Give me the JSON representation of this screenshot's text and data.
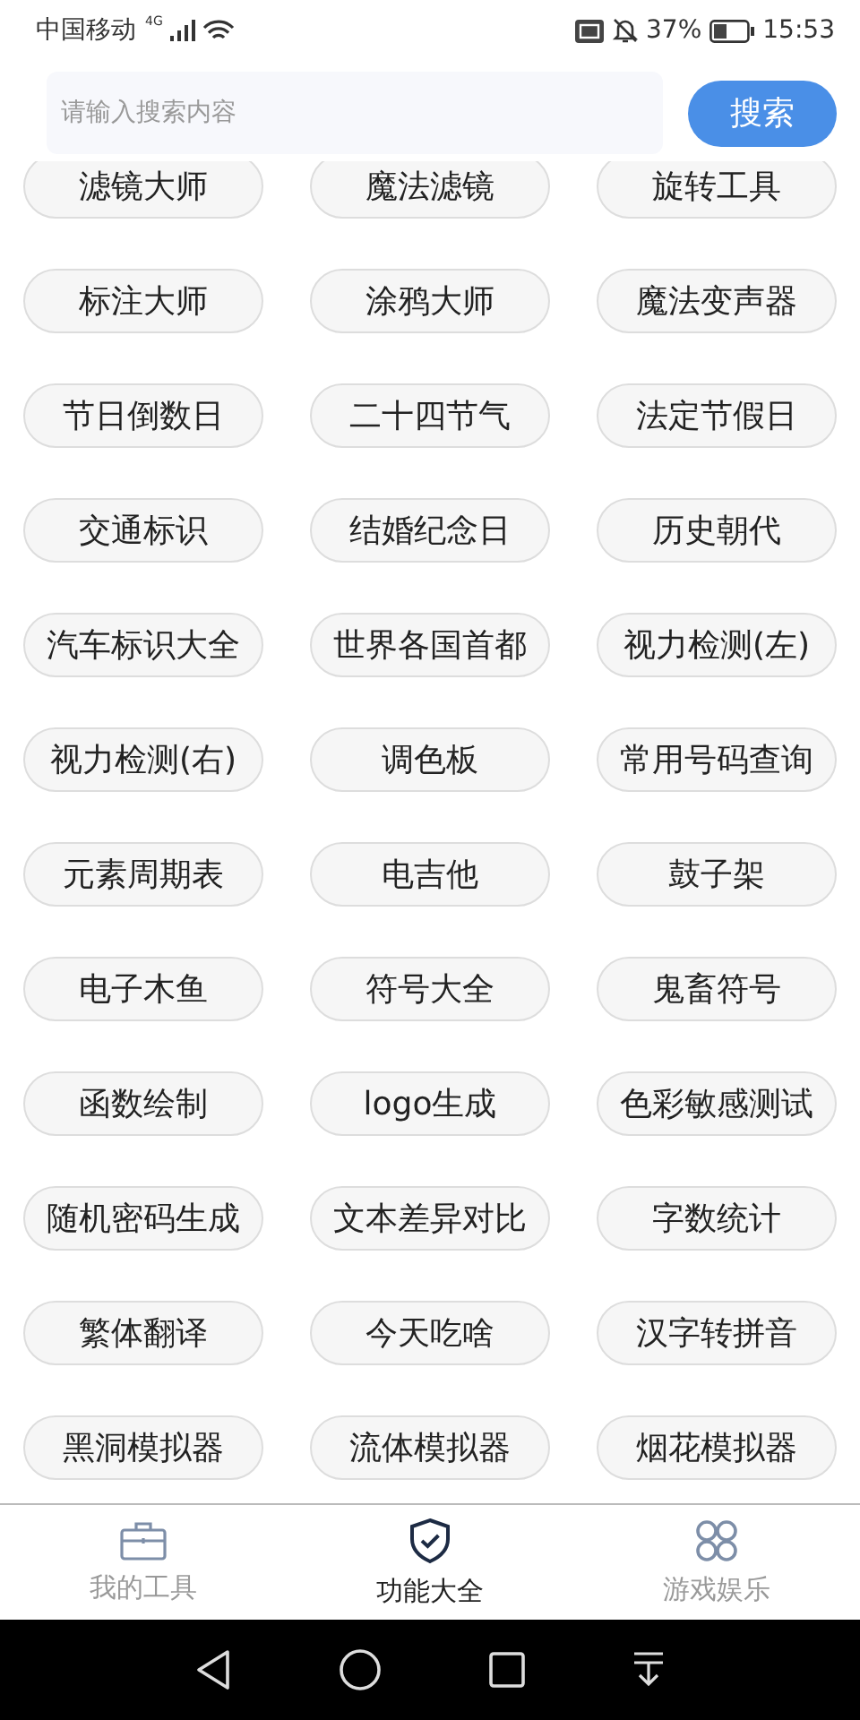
{
  "status_bar": {
    "carrier": "中国移动",
    "network": "4G",
    "battery": "37%",
    "time": "15:53"
  },
  "search": {
    "placeholder": "请输入搜索内容",
    "button": "搜索"
  },
  "tools": [
    "滤镜大师",
    "魔法滤镜",
    "旋转工具",
    "标注大师",
    "涂鸦大师",
    "魔法变声器",
    "节日倒数日",
    "二十四节气",
    "法定节假日",
    "交通标识",
    "结婚纪念日",
    "历史朝代",
    "汽车标识大全",
    "世界各国首都",
    "视力检测(左)",
    "视力检测(右)",
    "调色板",
    "常用号码查询",
    "元素周期表",
    "电吉他",
    "鼓子架",
    "电子木鱼",
    "符号大全",
    "鬼畜符号",
    "函数绘制",
    "logo生成",
    "色彩敏感测试",
    "随机密码生成",
    "文本差异对比",
    "字数统计",
    "繁体翻译",
    "今天吃啥",
    "汉字转拼音",
    "黑洞模拟器",
    "流体模拟器",
    "烟花模拟器"
  ],
  "tabs": [
    {
      "label": "我的工具",
      "kind": "toolbox",
      "selected": false
    },
    {
      "label": "功能大全",
      "kind": "shield",
      "selected": true
    },
    {
      "label": "游戏娱乐",
      "kind": "grid",
      "selected": false
    }
  ]
}
